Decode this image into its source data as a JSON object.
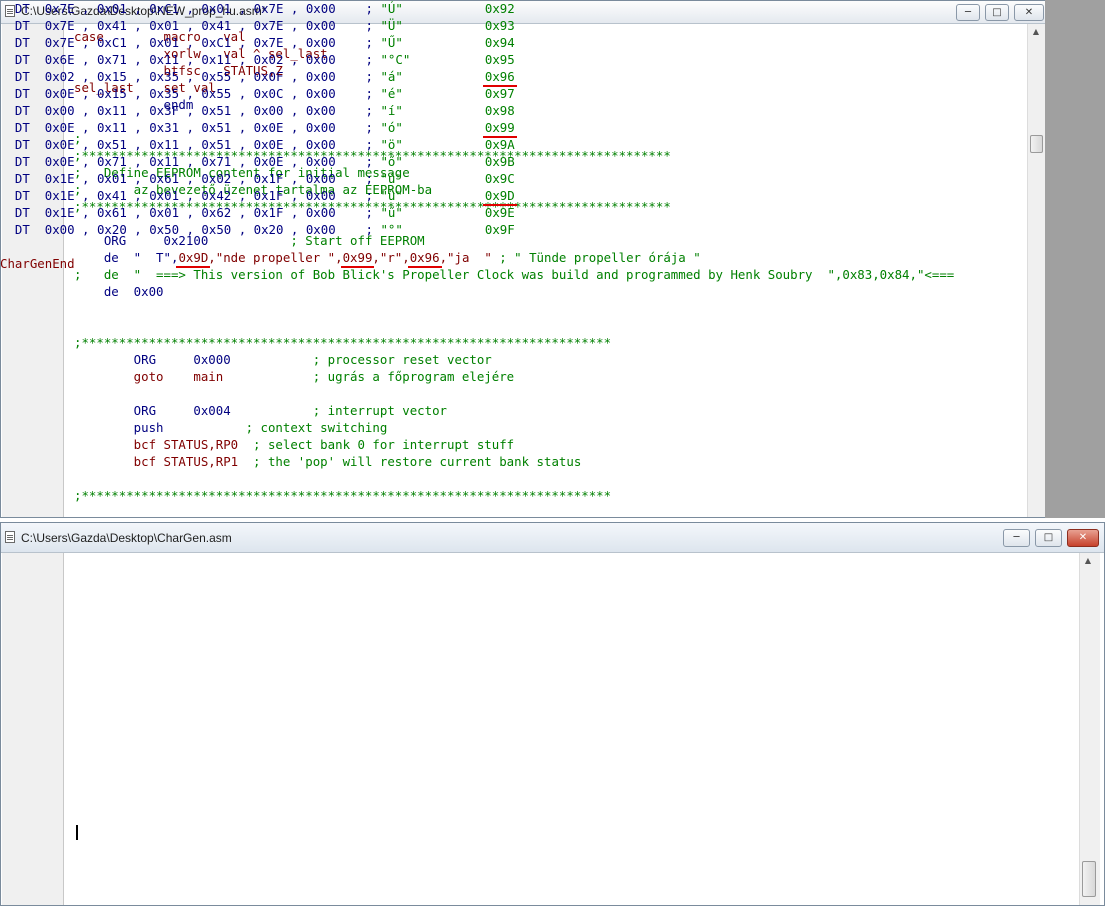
{
  "windows": [
    {
      "title": "C:\\Users\\Gazda\\Desktop\\NEW_prop_hu.asm*",
      "buttons": {
        "minimize": "─",
        "maximize": "□",
        "close": "✕"
      }
    },
    {
      "title": "C:\\Users\\Gazda\\Desktop\\CharGen.asm",
      "buttons": {
        "minimize": "─",
        "maximize": "□",
        "close": "✕"
      }
    }
  ],
  "editor1": {
    "lines": [
      "case        macro   val",
      "            xorlw   val ^ sel_last",
      "            btfsc   STATUS,Z",
      "sel_last    set val",
      "            endm",
      "",
      ";",
      ";*******************************************************************************",
      ";   Define EEPROM content for initial message",
      ";       az bevezető üzenet tartalma az EEPROM-ba",
      ";*******************************************************************************",
      "",
      "    ORG     0x2100           ; Start off EEPROM",
      "    de  \"  T\",0x9D,\"nde propeller \",0x99,\"r\",0x96,\"ja  \" ; \" Tünde propeller órája \"",
      ";   de  \"  ===> This version of Bob Blick's Propeller Clock was build and programmed by Henk Soubry  \",0x83,0x84,\"<===",
      "    de  0x00",
      "",
      "",
      ";***********************************************************************",
      "        ORG     0x000           ; processor reset vector",
      "        goto    main            ; ugrás a főprogram elejére",
      "",
      "        ORG     0x004           ; interrupt vector",
      "        push           ; context switching",
      "        bcf STATUS,RP0  ; select bank 0 for interrupt stuff",
      "        bcf STATUS,RP1  ; the 'pop' will restore current bank status",
      "",
      ";***********************************************************************"
    ],
    "underlined_tokens": [
      "0x9D",
      "0x99",
      "0x96"
    ]
  },
  "editor2": {
    "rows": [
      {
        "dt": "DT",
        "b": [
          "0x7E",
          "0x01",
          "0xC1",
          "0x01",
          "0x7E",
          "0x00"
        ],
        "char": "\"Ú\"",
        "code": "0x92"
      },
      {
        "dt": "DT",
        "b": [
          "0x7E",
          "0x41",
          "0x01",
          "0x41",
          "0x7E",
          "0x00"
        ],
        "char": "\"Ü\"",
        "code": "0x93"
      },
      {
        "dt": "DT",
        "b": [
          "0x7E",
          "0xC1",
          "0x01",
          "0xC1",
          "0x7E",
          "0x00"
        ],
        "char": "\"Ű\"",
        "code": "0x94"
      },
      {
        "dt": "DT",
        "b": [
          "0x6E",
          "0x71",
          "0x11",
          "0x11",
          "0x02",
          "0x00"
        ],
        "char": "\"°C\"",
        "code": "0x95"
      },
      {
        "dt": "DT",
        "b": [
          "0x02",
          "0x15",
          "0x35",
          "0x55",
          "0x0F",
          "0x00"
        ],
        "char": "\"á\"",
        "code": "0x96"
      },
      {
        "dt": "DT",
        "b": [
          "0x0E",
          "0x15",
          "0x35",
          "0x55",
          "0x0C",
          "0x00"
        ],
        "char": "\"é\"",
        "code": "0x97"
      },
      {
        "dt": "DT",
        "b": [
          "0x00",
          "0x11",
          "0x3F",
          "0x51",
          "0x00",
          "0x00"
        ],
        "char": "\"í\"",
        "code": "0x98"
      },
      {
        "dt": "DT",
        "b": [
          "0x0E",
          "0x11",
          "0x31",
          "0x51",
          "0x0E",
          "0x00"
        ],
        "char": "\"ó\"",
        "code": "0x99"
      },
      {
        "dt": "DT",
        "b": [
          "0x0E",
          "0x51",
          "0x11",
          "0x51",
          "0x0E",
          "0x00"
        ],
        "char": "\"ö\"",
        "code": "0x9A"
      },
      {
        "dt": "DT",
        "b": [
          "0x0E",
          "0x71",
          "0x11",
          "0x71",
          "0x0E",
          "0x00"
        ],
        "char": "\"ő\"",
        "code": "0x9B"
      },
      {
        "dt": "DT",
        "b": [
          "0x1E",
          "0x01",
          "0x61",
          "0x02",
          "0x1F",
          "0x00"
        ],
        "char": "\"ú\"",
        "code": "0x9C"
      },
      {
        "dt": "DT",
        "b": [
          "0x1E",
          "0x41",
          "0x01",
          "0x42",
          "0x1F",
          "0x00"
        ],
        "char": "\"ü\"",
        "code": "0x9D"
      },
      {
        "dt": "DT",
        "b": [
          "0x1E",
          "0x61",
          "0x01",
          "0x62",
          "0x1F",
          "0x00"
        ],
        "char": "\"ű\"",
        "code": "0x9E"
      },
      {
        "dt": "DT",
        "b": [
          "0x00",
          "0x20",
          "0x50",
          "0x50",
          "0x20",
          "0x00"
        ],
        "char": "\"°\"",
        "code": "0x9F"
      }
    ],
    "end_label": "CharGenEnd",
    "underlined_codes": [
      "0x96",
      "0x99",
      "0x9D"
    ]
  },
  "colors": {
    "underline": "#e00000",
    "keyword": "#800000",
    "directive": "#000080",
    "comment": "#008000"
  }
}
